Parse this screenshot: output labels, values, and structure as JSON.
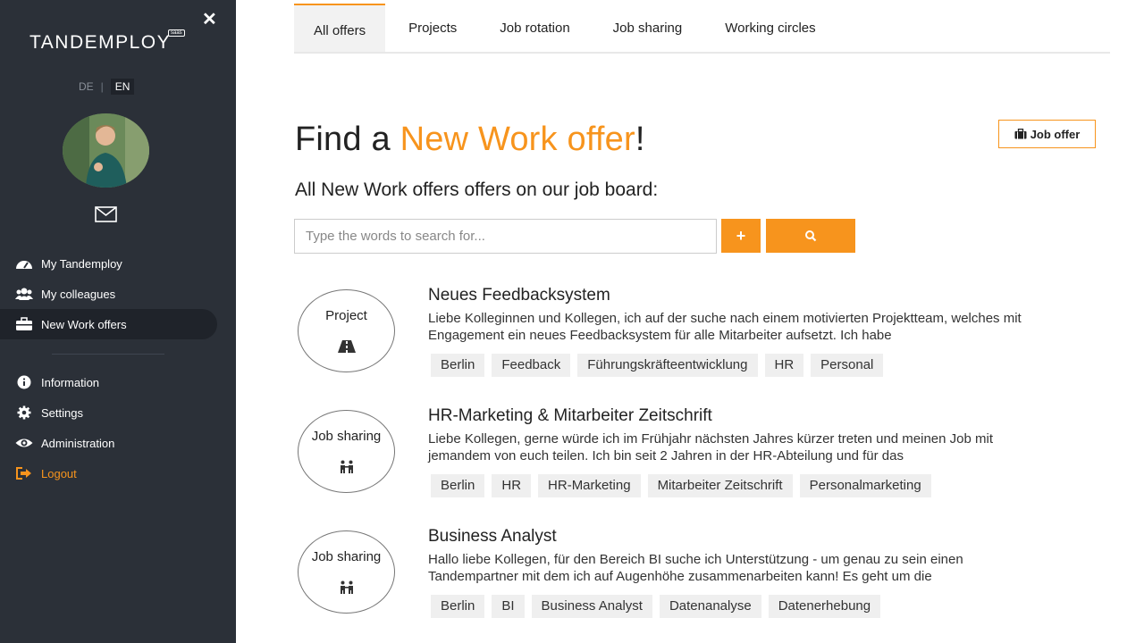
{
  "sidebar": {
    "logo": "TANDEMPLOY",
    "logo_badge": "saas",
    "lang": {
      "de": "DE",
      "sep": "|",
      "en": "EN"
    },
    "nav": [
      {
        "label": "My Tandemploy",
        "icon": "dashboard-icon"
      },
      {
        "label": "My colleagues",
        "icon": "users-icon"
      },
      {
        "label": "New Work offers",
        "icon": "briefcase-icon",
        "active": true
      },
      {
        "label": "Information",
        "icon": "info-icon"
      },
      {
        "label": "Settings",
        "icon": "gear-icon"
      },
      {
        "label": "Administration",
        "icon": "eye-icon"
      },
      {
        "label": "Logout",
        "icon": "logout-icon"
      }
    ]
  },
  "tabs": [
    "All offers",
    "Projects",
    "Job rotation",
    "Job sharing",
    "Working circles"
  ],
  "heading": {
    "prefix": "Find a ",
    "highlight": "New Work offer",
    "suffix": "!"
  },
  "job_offer_button": "Job offer",
  "subheading": "All New Work offers offers on our job board:",
  "search": {
    "placeholder": "Type the words to search for...",
    "add": "+"
  },
  "colors": {
    "accent": "#f7941d",
    "sidebar": "#2b3038"
  },
  "offers": [
    {
      "type": "Project",
      "icon": "road-icon",
      "title": "Neues Feedbacksystem",
      "desc": "Liebe Kolleginnen und Kollegen, ich auf der suche nach einem motivierten Projektteam, welches mit Engagement ein neues Feedbacksystem für alle Mitarbeiter aufsetzt. Ich habe",
      "tags": [
        "Berlin",
        "Feedback",
        "Führungskräfteentwicklung",
        "HR",
        "Personal"
      ]
    },
    {
      "type": "Job sharing",
      "icon": "tandem-icon",
      "title": "HR-Marketing & Mitarbeiter Zeitschrift",
      "desc": "Liebe Kollegen, gerne würde ich im Frühjahr nächsten Jahres kürzer treten und meinen Job mit jemandem von euch teilen. Ich bin seit 2 Jahren in der HR-Abteilung und für das",
      "tags": [
        "Berlin",
        "HR",
        "HR-Marketing",
        "Mitarbeiter Zeitschrift",
        "Personalmarketing"
      ]
    },
    {
      "type": "Job sharing",
      "icon": "tandem-icon",
      "title": "Business Analyst",
      "desc": "Hallo liebe Kollegen, für den Bereich BI suche ich Unterstützung - um genau zu sein einen Tandempartner mit dem ich auf Augenhöhe zusammenarbeiten kann! Es geht um die",
      "tags": [
        "Berlin",
        "BI",
        "Business Analyst",
        "Datenanalyse",
        "Datenerhebung"
      ]
    }
  ]
}
